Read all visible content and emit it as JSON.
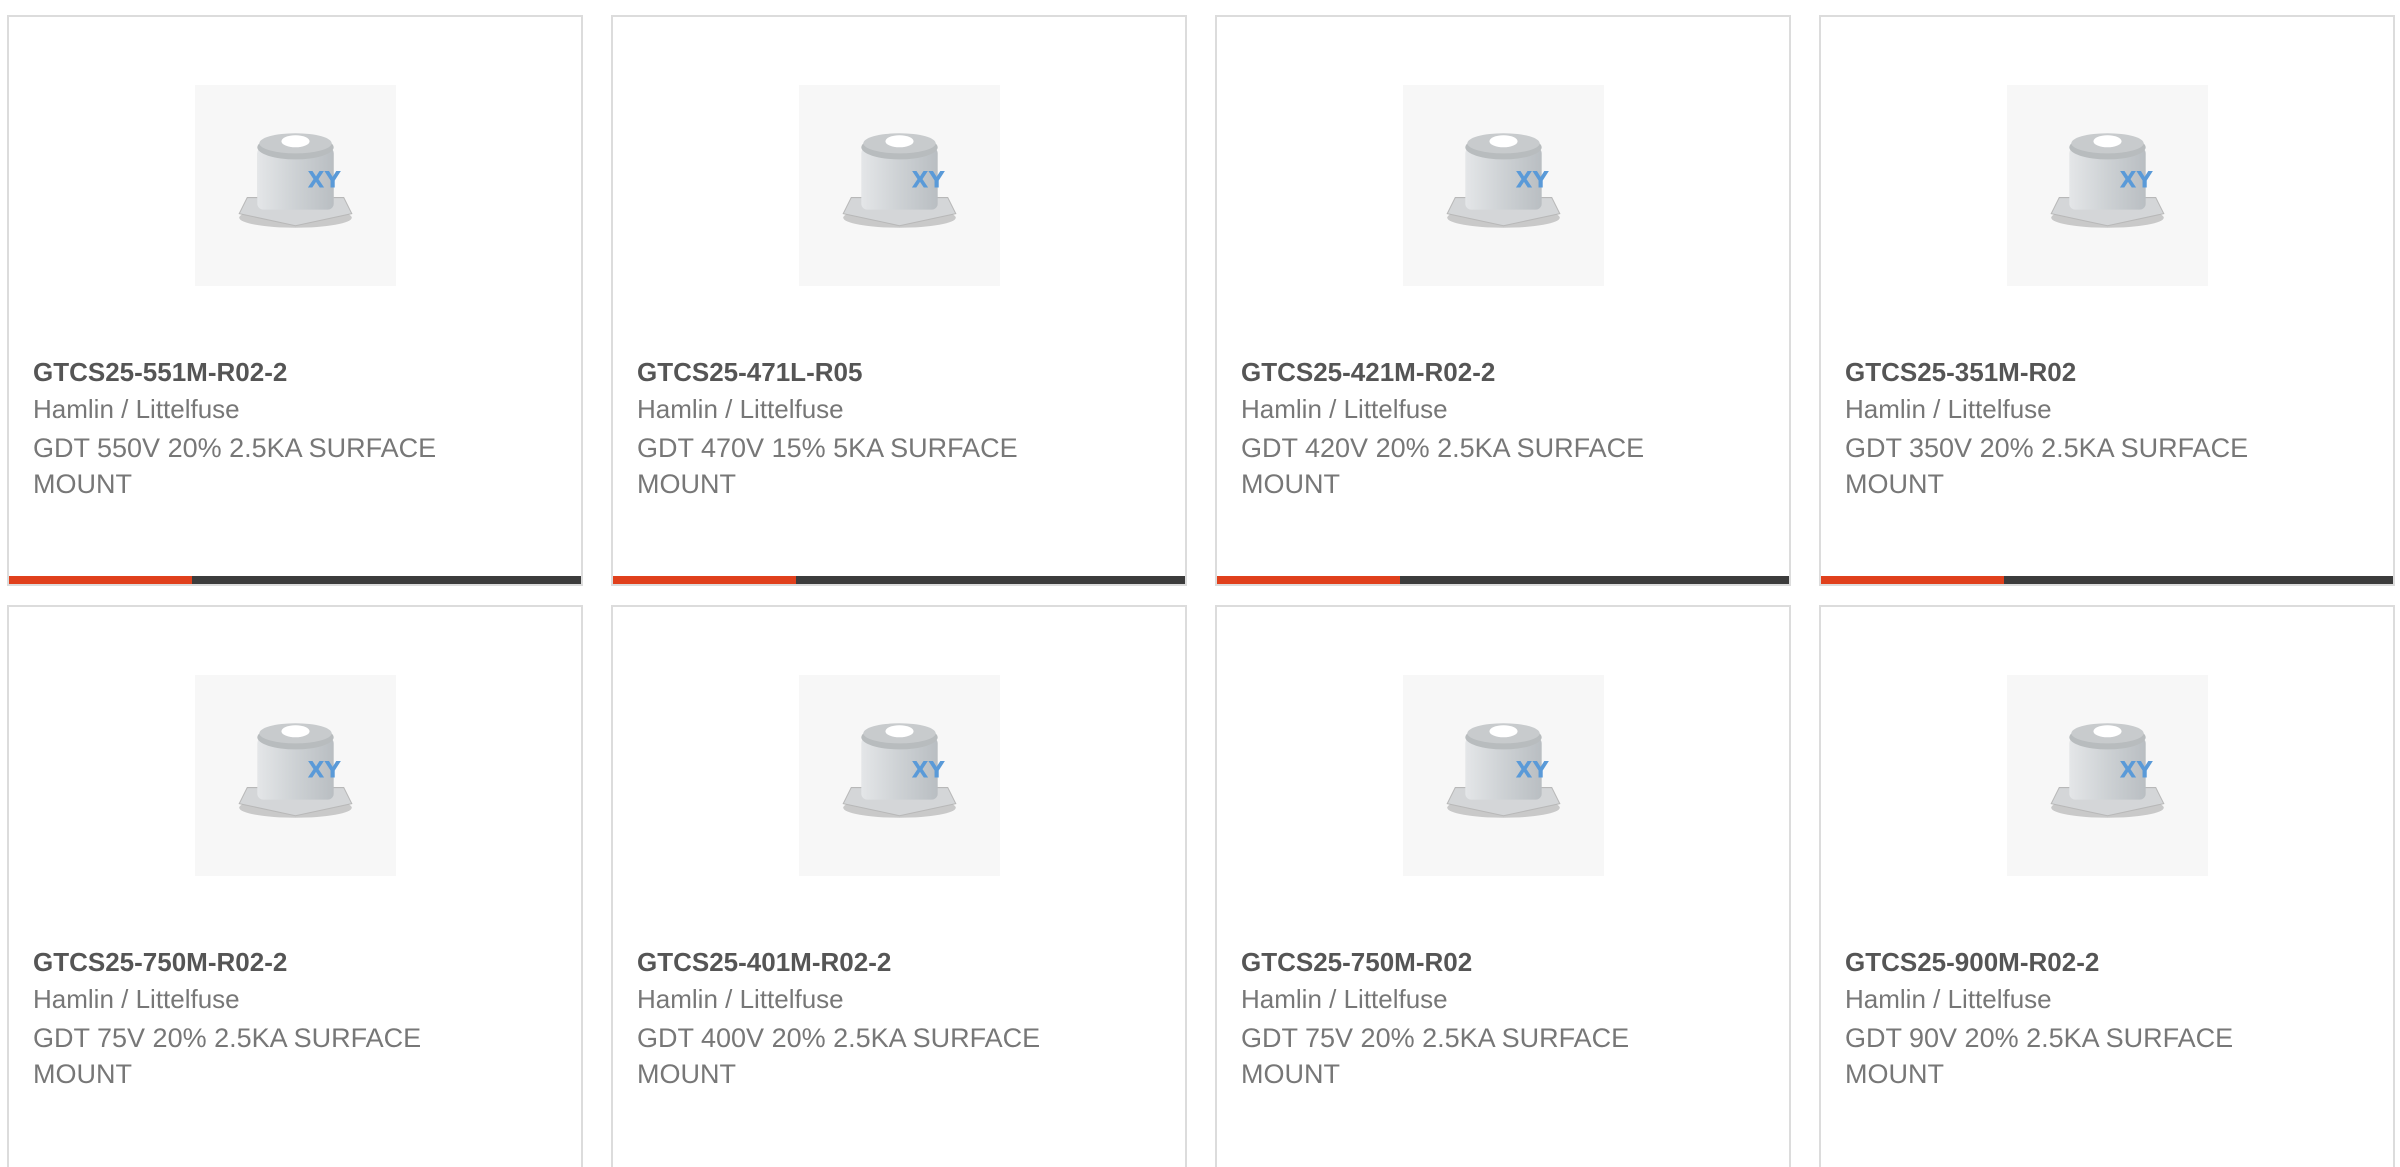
{
  "colors": {
    "accent": "#e0401c",
    "bar": "#3c3c3c",
    "border": "#dcdcdc",
    "part_text": "#555555",
    "body_text": "#777777"
  },
  "products": [
    {
      "part_number": "GTCS25-551M-R02-2",
      "manufacturer": "Hamlin / Littelfuse",
      "description": "GDT 550V 20% 2.5KA SURFACE MOUNT",
      "image_icon": "gas-discharge-tube-image"
    },
    {
      "part_number": "GTCS25-471L-R05",
      "manufacturer": "Hamlin / Littelfuse",
      "description": "GDT 470V 15% 5KA SURFACE MOUNT",
      "image_icon": "gas-discharge-tube-image"
    },
    {
      "part_number": "GTCS25-421M-R02-2",
      "manufacturer": "Hamlin / Littelfuse",
      "description": "GDT 420V 20% 2.5KA SURFACE MOUNT",
      "image_icon": "gas-discharge-tube-image"
    },
    {
      "part_number": "GTCS25-351M-R02",
      "manufacturer": "Hamlin / Littelfuse",
      "description": "GDT 350V 20% 2.5KA SURFACE MOUNT",
      "image_icon": "gas-discharge-tube-image"
    },
    {
      "part_number": "GTCS25-750M-R02-2",
      "manufacturer": "Hamlin / Littelfuse",
      "description": "GDT 75V 20% 2.5KA SURFACE MOUNT",
      "image_icon": "gas-discharge-tube-image"
    },
    {
      "part_number": "GTCS25-401M-R02-2",
      "manufacturer": "Hamlin / Littelfuse",
      "description": "GDT 400V 20% 2.5KA SURFACE MOUNT",
      "image_icon": "gas-discharge-tube-image"
    },
    {
      "part_number": "GTCS25-750M-R02",
      "manufacturer": "Hamlin / Littelfuse",
      "description": "GDT 75V 20% 2.5KA SURFACE MOUNT",
      "image_icon": "gas-discharge-tube-image"
    },
    {
      "part_number": "GTCS25-900M-R02-2",
      "manufacturer": "Hamlin / Littelfuse",
      "description": "GDT 90V 20% 2.5KA SURFACE MOUNT",
      "image_icon": "gas-discharge-tube-image"
    }
  ]
}
